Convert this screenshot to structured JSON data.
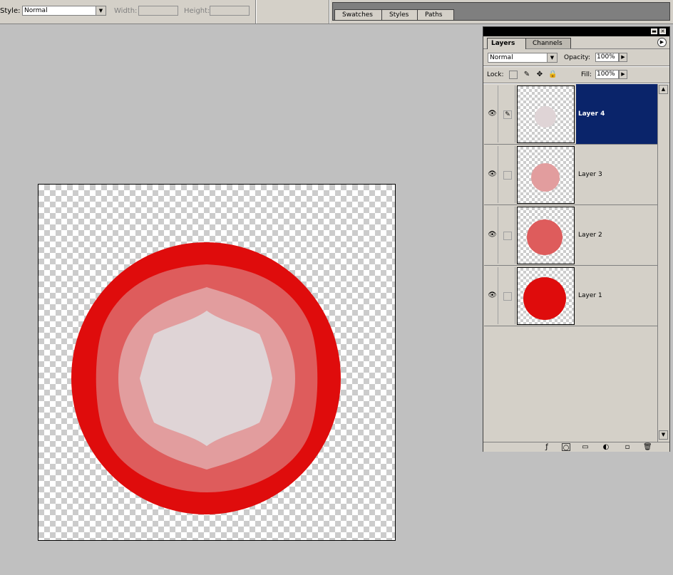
{
  "options_bar": {
    "style_label": "Style:",
    "style_value": "Normal",
    "width_label": "Width:",
    "height_label": "Height:",
    "dropdown_icon": "chevron-down-icon"
  },
  "palette_well": {
    "tabs": [
      "Swatches",
      "Styles",
      "Paths"
    ]
  },
  "layers_palette": {
    "tabs": {
      "layers": "Layers",
      "channels": "Channels"
    },
    "blend_mode": "Normal",
    "opacity_label": "Opacity:",
    "opacity_value": "100%",
    "lock_label": "Lock:",
    "fill_label": "Fill:",
    "fill_value": "100%",
    "layers": [
      {
        "name": "Layer 4",
        "selected": true,
        "visible": true,
        "color": "#dfd4d6",
        "brush_linked": true
      },
      {
        "name": "Layer 3",
        "selected": false,
        "visible": true,
        "color": "#e29d9e"
      },
      {
        "name": "Layer 2",
        "selected": false,
        "visible": true,
        "color": "#de5c5c"
      },
      {
        "name": "Layer 1",
        "selected": false,
        "visible": true,
        "color": "#df0c0c"
      }
    ],
    "footer_icons": [
      "layer-style-icon",
      "mask-icon",
      "folder-icon",
      "adjustment-layer-icon",
      "new-layer-icon",
      "trash-icon"
    ]
  },
  "canvas": {
    "colors": {
      "layer1": "#df0c0c",
      "layer2": "#de5c5c",
      "layer3": "#e29d9e",
      "layer4": "#dfd4d6"
    }
  }
}
